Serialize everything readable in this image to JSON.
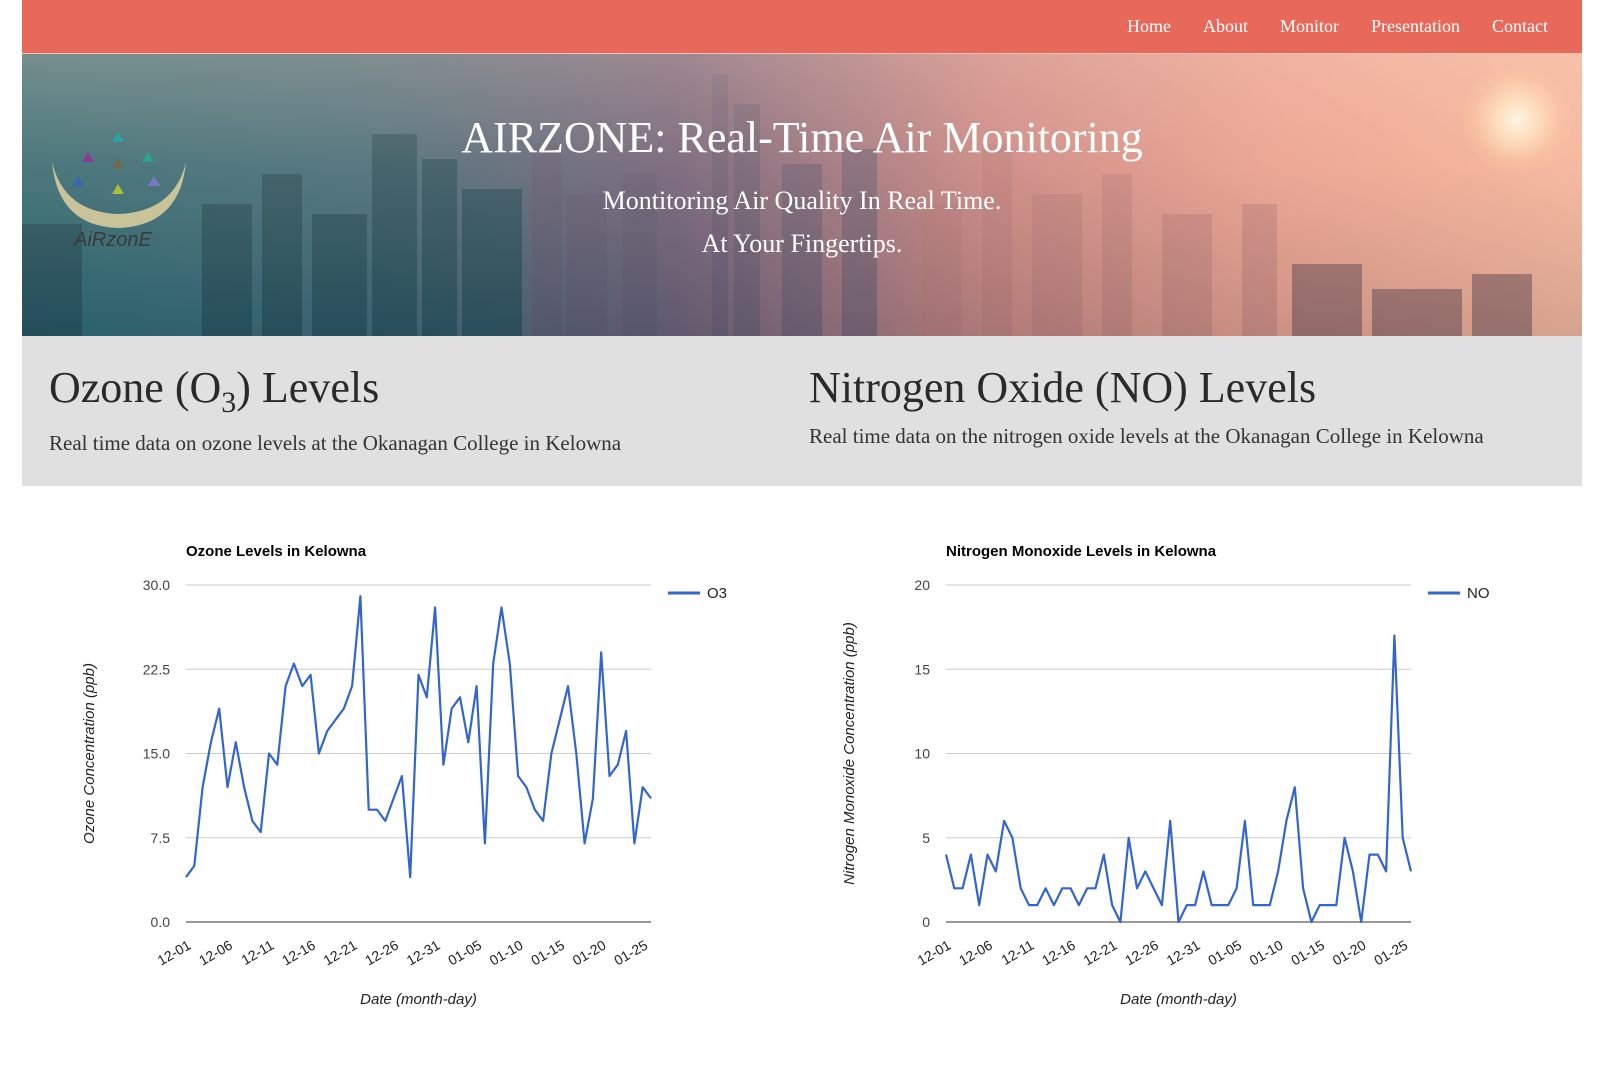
{
  "nav": {
    "items": [
      "Home",
      "About",
      "Monitor",
      "Presentation",
      "Contact"
    ]
  },
  "hero": {
    "title": "AIRZONE: Real-Time Air Monitoring",
    "subtitle_line1": "Montitoring Air Quality In Real Time.",
    "subtitle_line2": "At Your Fingertips.",
    "logo_text": "AiRzonE"
  },
  "sections": {
    "ozone": {
      "heading_prefix": "Ozone (O",
      "heading_sub": "3",
      "heading_suffix": ") Levels",
      "description": "Real time data on ozone levels at the Okanagan College in Kelowna"
    },
    "no": {
      "heading": "Nitrogen Oxide (NO) Levels",
      "description": "Real time data on the nitrogen oxide levels at the Okanagan College in Kelowna"
    }
  },
  "colors": {
    "nav_bg": "#e8695a",
    "band_bg": "#e0e0e0",
    "series": "#3366cc"
  },
  "chart_data": [
    {
      "type": "line",
      "title": "Ozone Levels in Kelowna",
      "xlabel": "Date (month-day)",
      "ylabel": "Ozone Concentration (ppb)",
      "ylim": [
        0,
        30
      ],
      "yticks": [
        "0.0",
        "7.5",
        "15.0",
        "22.5",
        "30.0"
      ],
      "xtick_labels": [
        "12-01",
        "12-06",
        "12-11",
        "12-16",
        "12-21",
        "12-26",
        "12-31",
        "01-05",
        "01-10",
        "01-15",
        "01-20",
        "01-25"
      ],
      "legend_position": "right",
      "grid": true,
      "series": [
        {
          "name": "O3",
          "values": [
            4,
            5,
            12,
            16,
            19,
            12,
            16,
            12,
            9,
            8,
            15,
            14,
            21,
            23,
            21,
            22,
            15,
            17,
            18,
            19,
            21,
            29,
            10,
            10,
            9,
            11,
            13,
            4,
            22,
            20,
            28,
            14,
            19,
            20,
            16,
            21,
            7,
            23,
            28,
            23,
            13,
            12,
            10,
            9,
            15,
            18,
            21,
            15,
            7,
            11,
            24,
            13,
            14,
            17,
            7,
            12,
            11
          ]
        }
      ]
    },
    {
      "type": "line",
      "title": "Nitrogen Monoxide Levels in Kelowna",
      "xlabel": "Date (month-day)",
      "ylabel": "Nitrogen Monoxide Concentration (ppb)",
      "ylim": [
        0,
        20
      ],
      "yticks": [
        "0",
        "5",
        "10",
        "15",
        "20"
      ],
      "xtick_labels": [
        "12-01",
        "12-06",
        "12-11",
        "12-16",
        "12-21",
        "12-26",
        "12-31",
        "01-05",
        "01-10",
        "01-15",
        "01-20",
        "01-25"
      ],
      "legend_position": "right",
      "grid": true,
      "series": [
        {
          "name": "NO",
          "values": [
            4,
            2,
            2,
            4,
            1,
            4,
            3,
            6,
            5,
            2,
            1,
            1,
            2,
            1,
            2,
            2,
            1,
            2,
            2,
            4,
            1,
            0,
            5,
            2,
            3,
            2,
            1,
            6,
            0,
            1,
            1,
            3,
            1,
            1,
            1,
            2,
            6,
            1,
            1,
            1,
            3,
            6,
            8,
            2,
            0,
            1,
            1,
            1,
            5,
            3,
            0,
            4,
            4,
            3,
            17,
            5,
            3
          ]
        }
      ]
    }
  ]
}
